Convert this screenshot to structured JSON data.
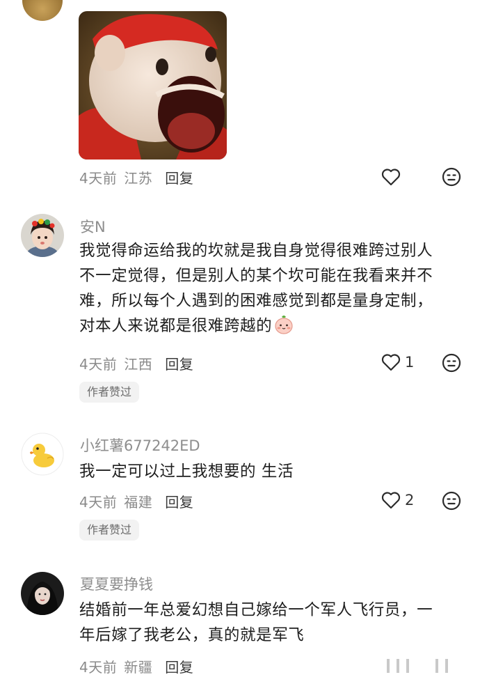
{
  "comments": [
    {
      "meta": {
        "time": "4天前",
        "location": "江苏",
        "reply_label": "回复"
      },
      "likes": ""
    },
    {
      "username": "安N",
      "text_lines": [
        "我觉得命运给我的坎就是我自身觉得很难跨过别人",
        "不一定觉得，但是别人的某个坎可能在我看来并不",
        "难，所以每个人遇到的困难感觉到都是量身定制，",
        "对本人来说都是很难跨越的"
      ],
      "meta": {
        "time": "4天前",
        "location": "江西",
        "reply_label": "回复"
      },
      "likes": "1",
      "badge": "作者赞过"
    },
    {
      "username": "小红薯677242ED",
      "text_lines": [
        "我一定可以过上我想要的 生活"
      ],
      "meta": {
        "time": "4天前",
        "location": "福建",
        "reply_label": "回复"
      },
      "likes": "2",
      "badge": "作者赞过"
    },
    {
      "username": "夏夏要挣钱",
      "text_lines": [
        "结婚前一年总爱幻想自己嫁给一个军人飞行员，一",
        "年后嫁了我老公，真的就是军飞"
      ],
      "meta": {
        "time": "4天前",
        "location": "新疆",
        "reply_label": "回复"
      }
    }
  ],
  "icons": {
    "like": "heart-outline-icon",
    "dislike": "dislike-face-icon",
    "inline_emoji": "peach-face-emoji"
  }
}
